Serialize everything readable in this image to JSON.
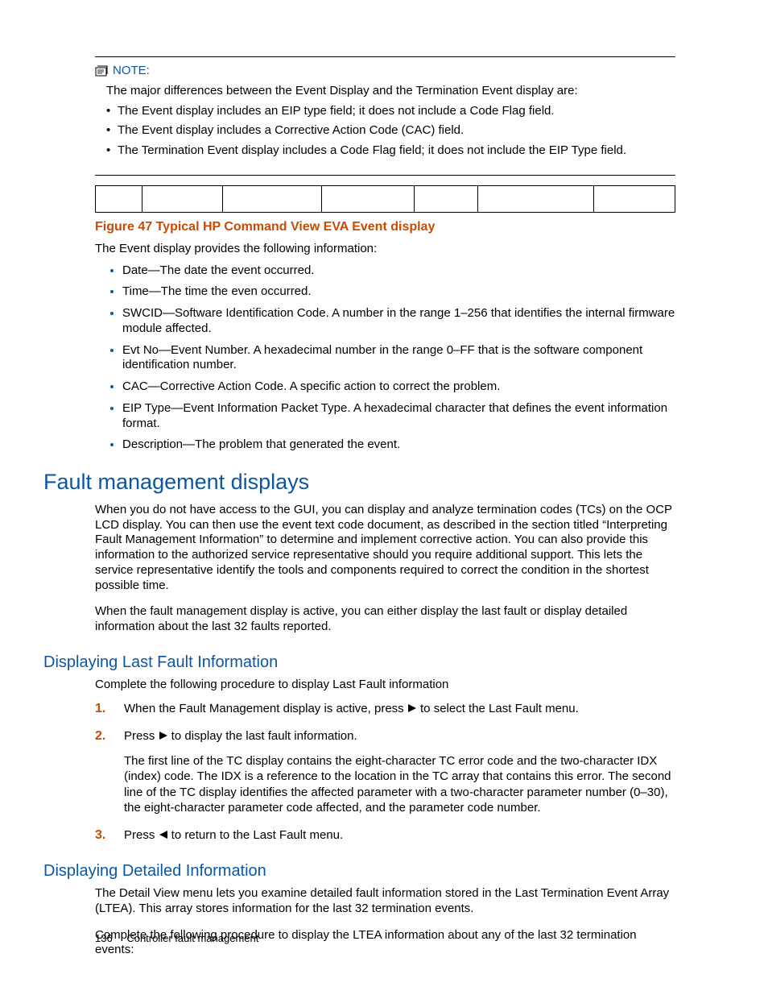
{
  "note": {
    "label": "NOTE:",
    "intro": "The major differences between the Event Display and the Termination Event display are:",
    "items": [
      "The Event display includes an EIP type field; it does not include a Code Flag field.",
      "The Event display includes a Corrective Action Code (CAC) field.",
      "The Termination Event display includes a Code Flag field; it does not include the EIP Type field."
    ]
  },
  "figure": {
    "caption": "Figure 47 Typical HP Command View EVA Event display",
    "columns": 7
  },
  "event_info": {
    "intro": "The Event display provides the following information:",
    "items": [
      "Date—The date the event occurred.",
      "Time—The time the even occurred.",
      "SWCID—Software Identification Code. A number in the range 1–256 that identifies the internal firmware module affected.",
      "Evt No—Event Number. A hexadecimal number in the range 0–FF that is the software component identification number.",
      "CAC—Corrective Action Code. A specific action to correct the problem.",
      "EIP Type—Event Information Packet Type. A hexadecimal character that defines the event information format.",
      "Description—The problem that generated the event."
    ]
  },
  "section": {
    "title": "Fault management displays",
    "p1": "When you do not have access to the GUI, you can display and analyze termination codes (TCs) on the OCP LCD display. You can then use the event text code document, as described in the section titled “Interpreting Fault Management Information” to determine and implement corrective action. You can also provide this information to the authorized service representative should you require additional support. This lets the service representative identify the tools and components required to correct the condition in the shortest possible time.",
    "p2": "When the fault management display is active, you can either display the last fault or display detailed information about the last 32 faults reported."
  },
  "sub1": {
    "title": "Displaying Last Fault Information",
    "intro": "Complete the following procedure to display Last Fault information",
    "steps": {
      "s1a": "When the Fault Management display is active, press ",
      "s1b": " to select the Last Fault menu.",
      "s2a": "Press ",
      "s2b": " to display the last fault information.",
      "s2para": "The first line of the TC display contains the eight-character TC error code and the two-character IDX (index) code. The IDX is a reference to the location in the TC array that contains this error. The second line of the TC display identifies the affected parameter with a two-character parameter number (0–30), the eight-character parameter code affected, and the parameter code number.",
      "s3a": "Press ",
      "s3b": " to return to the Last Fault menu."
    }
  },
  "sub2": {
    "title": "Displaying Detailed Information",
    "p1": "The Detail View menu lets you examine detailed fault information stored in the Last Termination Event Array (LTEA). This array stores information for the last 32 termination events.",
    "p2": "Complete the following procedure to display the LTEA information about any of the last 32 termination events:"
  },
  "footer": {
    "page": "136",
    "title": "Controller fault management"
  }
}
